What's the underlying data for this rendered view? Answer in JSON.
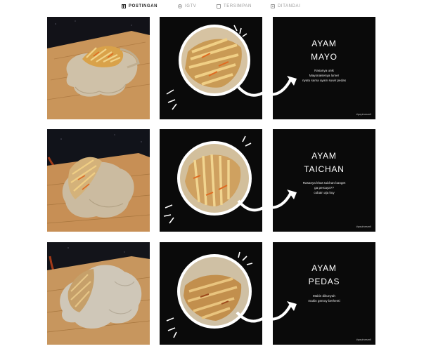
{
  "tabs": [
    {
      "label": "POSTINGAN",
      "icon": "grid-icon",
      "active": true
    },
    {
      "label": "IGTV",
      "icon": "igtv-icon",
      "active": false
    },
    {
      "label": "TERSIMPAN",
      "icon": "bookmark-icon",
      "active": false
    },
    {
      "label": "DITANDAI",
      "icon": "tag-icon",
      "active": false
    }
  ],
  "posts": [
    {
      "photo": "pastel-ayam-mayo-photo",
      "closeup": "ayam-mayo-closeup",
      "card": {
        "title_line1": "AYAM",
        "title_line2": "MAYO",
        "desc_line1": "Rasanya unik",
        "desc_line2": "Mayonaisenya lumer",
        "desc_line3": "nyatu sama ayam suwir pedas",
        "handle": "#pepinesmil"
      }
    },
    {
      "photo": "pastel-ayam-taichan-photo",
      "closeup": "ayam-taichan-closeup",
      "card": {
        "title_line1": "AYAM",
        "title_line2": "TAICHAN",
        "desc_line1": "Rasanya khas taichan banget",
        "desc_line2": "ga percaya??",
        "desc_line3": "cobain aja kuy",
        "handle": "#pepinesmil"
      }
    },
    {
      "photo": "pastel-ayam-pedas-photo",
      "closeup": "ayam-pedas-closeup",
      "card": {
        "title_line1": "AYAM",
        "title_line2": "PEDAS",
        "desc_line1": "Makin dikunyah",
        "desc_line2": "makin gemoy berhenti",
        "desc_line3": "",
        "handle": "#pepinesmil"
      }
    }
  ],
  "colors": {
    "tile_black": "#0a0a0a",
    "board_wood": "#c9955a",
    "pastry": "#cfc1a8",
    "filling": "#d9a24a"
  }
}
